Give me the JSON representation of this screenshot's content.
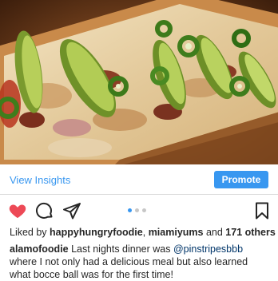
{
  "post": {
    "image_alt": "Flatbread pizza topped with avocado slices, jalapeños and bacon",
    "insights_label": "View Insights",
    "promote_label": "Promote"
  },
  "actions": {
    "like_icon": "heart-filled-icon",
    "comment_icon": "comment-icon",
    "share_icon": "share-icon",
    "save_icon": "bookmark-icon",
    "like_color": "#ed4956",
    "carousel_total": 3,
    "carousel_active": 1
  },
  "likes": {
    "prefix": "Liked by",
    "user1": "happyhungryfoodie",
    "separator": ",",
    "user2": "miamiyums",
    "and": "and",
    "others": "171 others"
  },
  "caption": {
    "username": "alamofoodie",
    "text_before": "Last nights dinner was",
    "mention": "@pinstripesbbb",
    "text_after": "where I not only had a delicious meal but also learned what bocce ball was for the first time!"
  }
}
